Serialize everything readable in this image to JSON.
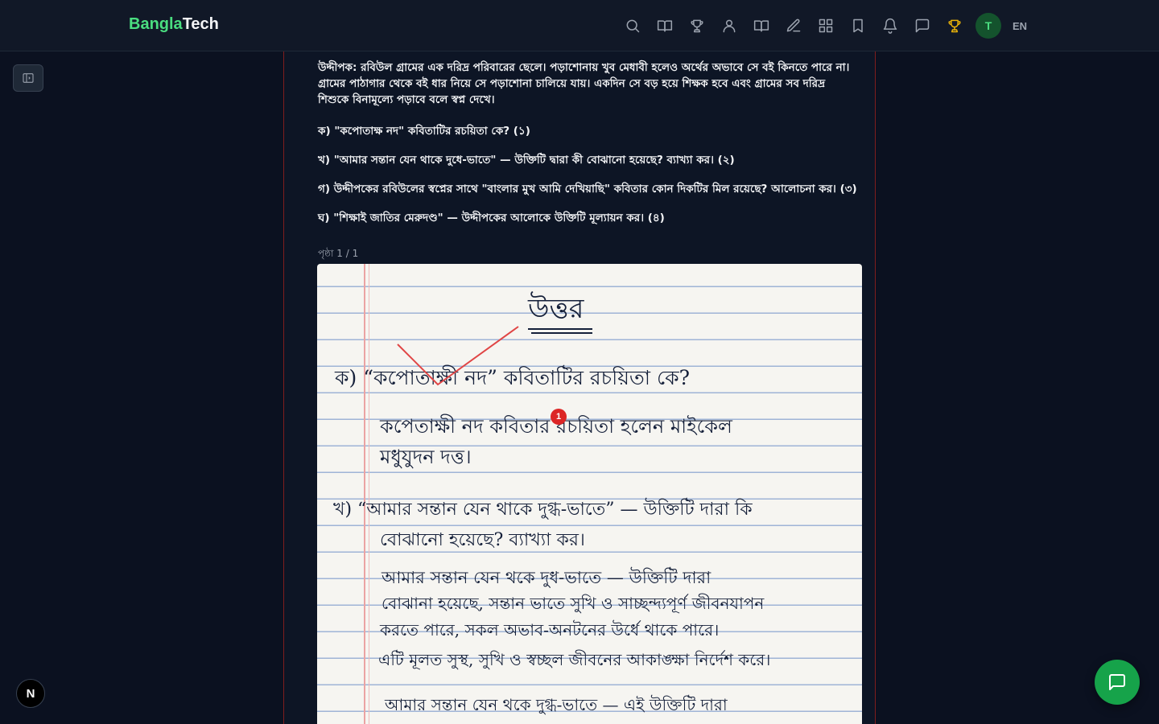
{
  "header": {
    "brand_part1": "Bangla",
    "brand_part2": "Tech",
    "nav_icons": [
      "search-icon",
      "book-open-icon",
      "trophy-icon",
      "users-icon",
      "library-icon",
      "edit-icon",
      "grid-icon",
      "bookmark-icon",
      "bell-icon",
      "message-icon",
      "trophy-active-icon"
    ],
    "avatar_initial": "T",
    "language": "EN"
  },
  "question": {
    "stimulus": "উদ্দীপক: রবিউল গ্রামের এক দরিদ্র পরিবারের ছেলে। পড়াশোনায় খুব মেধাবী হলেও অর্থের অভাবে সে বই কিনতে পারে না। গ্রামের পাঠাগার থেকে বই ধার নিয়ে সে পড়াশোনা চালিয়ে যায়। একদিন সে বড় হয়ে শিক্ষক হবে এবং গ্রামের সব দরিদ্র শিশুকে বিনামূল্যে পড়াবে বলে স্বপ্ন দেখে।",
    "items": [
      "ক) \"কপোতাক্ষ নদ\" কবিতাটির রচয়িতা কে? (১)",
      "খ) \"আমার সন্তান যেন থাকে দুধে-ভাতে\" — উক্তিটি দ্বারা কী বোঝানো হয়েছে? ব্যাখ্যা কর। (২)",
      "গ) উদ্দীপকের রবিউলের স্বপ্নের সাথে \"বাংলার মুখ আমি দেখিয়াছি\" কবিতার কোন দিকটির মিল রয়েছে? আলোচনা কর। (৩)",
      "ঘ) \"শিক্ষাই জাতির মেরুদণ্ড\" — উদ্দীপকের আলোকে উক্তিটি মূল্যায়ন কর। (৪)"
    ]
  },
  "answer_sheet": {
    "page_indicator": "পৃষ্ঠা 1 / 1",
    "title": "উত্তর",
    "lines": [
      "ক)  “কপোতাক্ষী নদ” কবিতাটির রচয়িতা কে?",
      "কপেতাক্ষী নদ কবিতার রচয়িতা হলেন  মাইকেল",
      "মধুযুদন দত্ত।",
      "খ)  “আমার সন্তান যেন থাকে দুগ্ধ-ভাতে” — উক্তিটি দারা কি",
      "বোঝানো হয়েছে? ব্যাখ্যা কর।",
      "আমার সন্তান যেন থকে দুধ-ভাতে — উক্তিটি দারা",
      "বোঝানা হয়েছে, সন্তান ভাতে সুখি ও সাচ্ছন্দ্যপূর্ণ জীবনযাপন",
      "করতে পারে, সকল অভাব-অনটনের উর্ধে থাকে পারে।",
      "এটি মূলত সুস্থ, সুখি ও স্বচ্ছল জীবনের আকাঙ্ক্ষা নির্দেশ করে।",
      "আমার সন্তান যেন থকে দুগ্ধ-ভাতে — এই উক্তিটি দারা"
    ],
    "annotation_badge": "1"
  },
  "fab": {
    "n_badge": "N"
  },
  "colors": {
    "brand_green": "#4ade80",
    "accent_yellow": "#eab308",
    "fab_green": "#16a34a",
    "annotation_red": "#dc2626"
  }
}
